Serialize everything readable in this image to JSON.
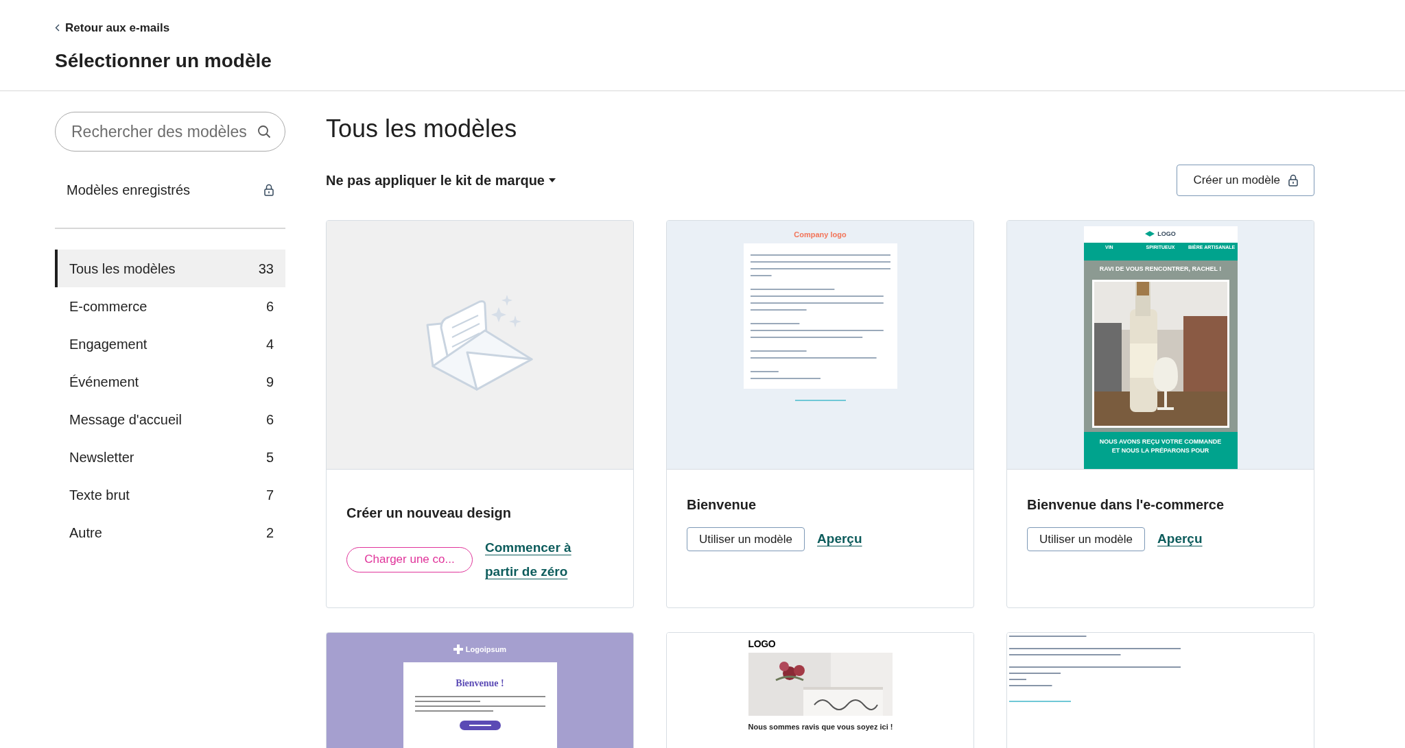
{
  "header": {
    "back_link": "Retour aux e-mails",
    "title": "Sélectionner un modèle"
  },
  "sidebar": {
    "search": {
      "placeholder": "Rechercher des modèles"
    },
    "saved": {
      "label": "Modèles enregistrés"
    },
    "items": [
      {
        "label": "Tous les modèles",
        "count": "33",
        "selected": true
      },
      {
        "label": "E-commerce",
        "count": "6",
        "selected": false
      },
      {
        "label": "Engagement",
        "count": "4",
        "selected": false
      },
      {
        "label": "Événement",
        "count": "9",
        "selected": false
      },
      {
        "label": "Message d'accueil",
        "count": "6",
        "selected": false
      },
      {
        "label": "Newsletter",
        "count": "5",
        "selected": false
      },
      {
        "label": "Texte brut",
        "count": "7",
        "selected": false
      },
      {
        "label": "Autre",
        "count": "2",
        "selected": false
      }
    ]
  },
  "main": {
    "title": "Tous les modèles",
    "brand_kit": "Ne pas appliquer le kit de marque",
    "create_button": {
      "label": "Créer un modèle"
    },
    "cards": [
      {
        "kind": "new",
        "title": "Créer un nouveau design",
        "upload": "Charger une co...",
        "start": "Commencer à partir de zéro"
      },
      {
        "kind": "newsletter",
        "title": "Bienvenue",
        "use": "Utiliser un modèle",
        "preview": "Aperçu",
        "thumb": {
          "logo": "Company logo"
        }
      },
      {
        "kind": "ecommerce",
        "title": "Bienvenue dans l'e-commerce",
        "use": "Utiliser un modèle",
        "preview": "Aperçu",
        "thumb": {
          "logo": "LOGO",
          "nav": [
            "VIN",
            "SPIRITUEUX",
            "BIÈRE ARTISANALE"
          ],
          "greeting": "RAVI DE VOUS RENCONTRER, RACHEL !",
          "message": "NOUS AVONS REÇU VOTRE COMMANDE ET NOUS LA PRÉPARONS POUR"
        }
      },
      {
        "kind": "welcome-purple",
        "thumb": {
          "logo": "Logoipsum",
          "heading": "Bienvenue !"
        }
      },
      {
        "kind": "welcome-photo",
        "thumb": {
          "logo": "LOGO",
          "heading": "Nous sommes ravis que vous soyez ici !"
        }
      },
      {
        "kind": "plain"
      }
    ]
  }
}
